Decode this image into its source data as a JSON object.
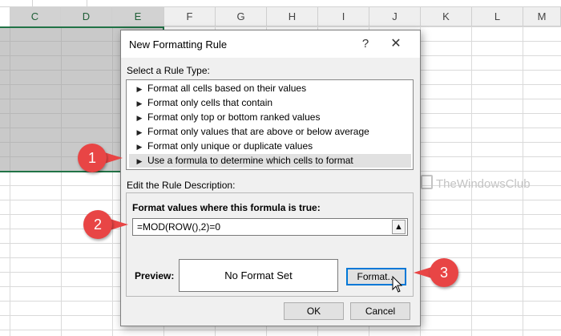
{
  "spreadsheet": {
    "columns": [
      "C",
      "D",
      "E",
      "F",
      "G",
      "H",
      "I",
      "J",
      "K",
      "L",
      "M"
    ],
    "selected_columns": [
      "C",
      "D",
      "E"
    ],
    "accent_color": "#217346"
  },
  "watermark": {
    "text": "TheWindowsClub"
  },
  "dialog": {
    "title": "New Formatting Rule",
    "help_label": "?",
    "close_label": "✕",
    "rule_type_label": "Select a Rule Type:",
    "rule_types": [
      {
        "label": "Format all cells based on their values"
      },
      {
        "label": "Format only cells that contain"
      },
      {
        "label": "Format only top or bottom ranked values"
      },
      {
        "label": "Format only values that are above or below average"
      },
      {
        "label": "Format only unique or duplicate values"
      },
      {
        "label": "Use a formula to determine which cells to format"
      }
    ],
    "selected_rule_index": 5,
    "edit_description_label": "Edit the Rule Description:",
    "formula_label": "Format values where this formula is true:",
    "formula_value": "=MOD(ROW(),2)=0",
    "preview_label": "Preview:",
    "preview_text": "No Format Set",
    "format_button": "Format...",
    "ok_button": "OK",
    "cancel_button": "Cancel"
  },
  "callouts": [
    "1",
    "2",
    "3"
  ],
  "colors": {
    "callout": "#e84545",
    "focus": "#0078d7"
  }
}
